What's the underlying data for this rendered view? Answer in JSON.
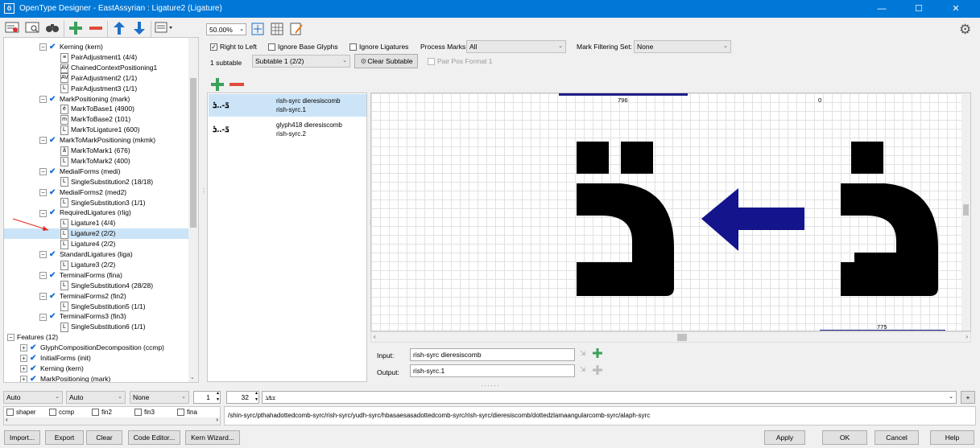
{
  "window": {
    "title": "OpenType Designer - EastAssyrian : Ligature2 (Ligature)",
    "minimize": "—",
    "maximize": "☐",
    "close": "✕"
  },
  "toolbar": {
    "zoom": "50.00%"
  },
  "tree": {
    "items": [
      {
        "label": "Kerning (kern)"
      },
      {
        "label": "PairAdjustment1 (4/4)"
      },
      {
        "label": "ChainedContextPositioning1"
      },
      {
        "label": "PairAdjustment2 (1/1)"
      },
      {
        "label": "PairAdjustment3 (1/1)"
      },
      {
        "label": "MarkPositioning (mark)"
      },
      {
        "label": "MarkToBase1 (4900)"
      },
      {
        "label": "MarkToBase2 (101)"
      },
      {
        "label": "MarkToLigature1 (600)"
      },
      {
        "label": "MarkToMarkPositioning (mkmk)"
      },
      {
        "label": "MarkToMark1 (676)"
      },
      {
        "label": "MarkToMark2 (400)"
      },
      {
        "label": "MedialForms (medi)"
      },
      {
        "label": "SingleSubstitution2 (18/18)"
      },
      {
        "label": "MedialForms2 (med2)"
      },
      {
        "label": "SingleSubstitution3 (1/1)"
      },
      {
        "label": "RequiredLigatures (rlig)"
      },
      {
        "label": "Ligature1 (4/4)"
      },
      {
        "label": "Ligature2 (2/2)"
      },
      {
        "label": "Ligature4 (2/2)"
      },
      {
        "label": "StandardLigatures (liga)"
      },
      {
        "label": "Ligature3 (2/2)"
      },
      {
        "label": "TerminalForms (fina)"
      },
      {
        "label": "SingleSubstitution4 (28/28)"
      },
      {
        "label": "TerminalForms2 (fin2)"
      },
      {
        "label": "SingleSubstitution5 (1/1)"
      },
      {
        "label": "TerminalForms3 (fin3)"
      },
      {
        "label": "SingleSubstitution6 (1/1)"
      },
      {
        "label": "Features (12)"
      },
      {
        "label": "GlyphCompositionDecomposition (ccmp)"
      },
      {
        "label": "InitialForms (init)"
      },
      {
        "label": "Kerning (kern)"
      },
      {
        "label": "MarkPositioning (mark)"
      }
    ]
  },
  "options": {
    "right_to_left": "Right to Left",
    "ignore_base": "Ignore Base Glyphs",
    "ignore_ligatures": "Ignore Ligatures",
    "process_marks_label": "Process Marks:",
    "process_marks_value": "All",
    "mark_filtering_label": "Mark Filtering Set:",
    "mark_filtering_value": "None",
    "subtable_count": "1 subtable",
    "subtable_value": "Subtable 1 (2/2)",
    "clear_subtable": "Clear Subtable",
    "pair_pos": "Pair Pos Format 1"
  },
  "glyph_list": [
    {
      "preview": "ܪ̈-..ܪ",
      "line1": "rish-syrc dieresiscomb",
      "line2": "rish-syrc.1"
    },
    {
      "preview": "ܪ̈-..ܪ",
      "line1": "glyph418 dieresiscomb",
      "line2": "rish-syrc.2"
    }
  ],
  "canvas": {
    "left_metric": "796",
    "right_metric": "0",
    "bottom_metric": "775"
  },
  "io": {
    "input_label": "Input:",
    "input_value": "rish-syrc dieresiscomb",
    "output_label": "Output:",
    "output_value": "rish-syrc.1"
  },
  "bottom": {
    "combo1": "Auto",
    "combo2": "Auto",
    "combo3": "None",
    "spin1": "1",
    "spin2": "32",
    "text_sample": "ܫܦܪ",
    "feature_boxes": [
      "shaper",
      "ccmp",
      "fin2",
      "fin3",
      "fina"
    ],
    "path": "/shin-syrc/pthahadottedcomb-syrc/rish-syrc/yudh-syrc/hbasaesasadottedcomb-syrc/rish-syrc/dieresiscomb/dottedzlamaangularcomb-syrc/alaph-syrc",
    "plus": "+"
  },
  "buttons": {
    "import": "Import...",
    "export": "Export",
    "clear": "Clear",
    "code_editor": "Code Editor...",
    "kern_wizard": "Kern Wizard...",
    "apply": "Apply",
    "ok": "OK",
    "cancel": "Cancel",
    "help": "Help"
  }
}
